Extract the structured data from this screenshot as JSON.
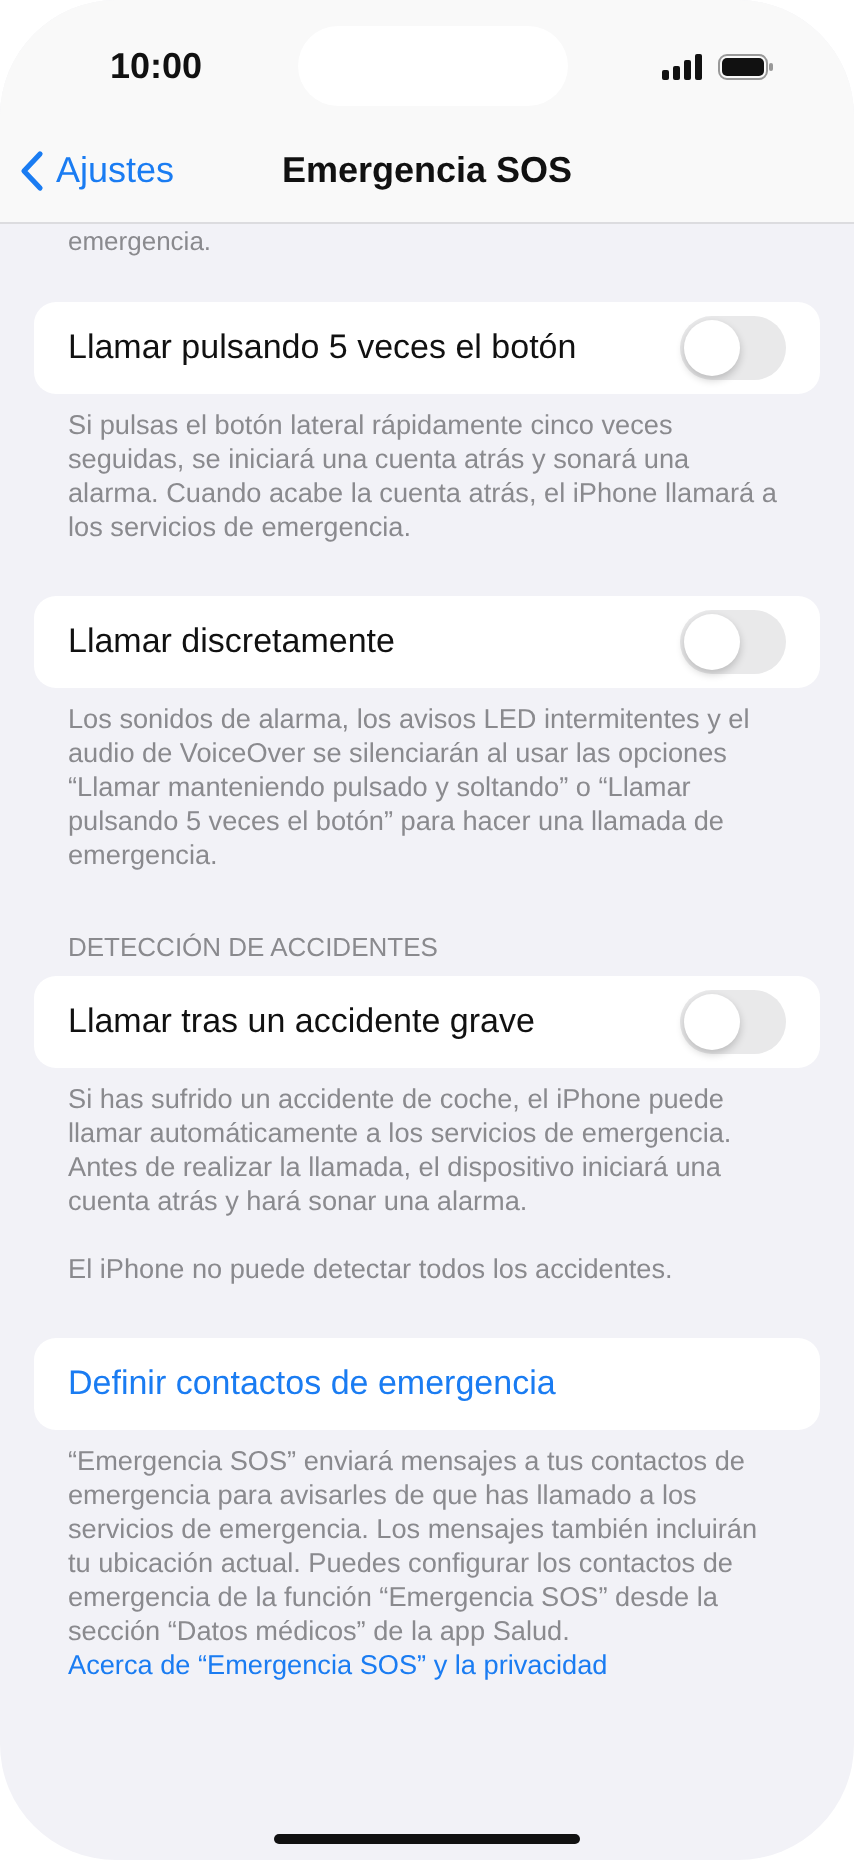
{
  "status_bar": {
    "time": "10:00"
  },
  "nav": {
    "back": "Ajustes",
    "title": "Emergencia SOS"
  },
  "cut_text": "emergencia.",
  "sections": [
    {
      "kind": "toggle",
      "label": "Llamar pulsando 5 veces el botón",
      "on": false,
      "footer": [
        "Si pulsas el botón lateral rápidamente cinco veces seguidas, se iniciará una cuenta atrás y sonará una alarma. Cuando acabe la cuenta atrás, el iPhone llamará a los servicios de emergencia."
      ]
    },
    {
      "kind": "toggle",
      "label": "Llamar discretamente",
      "on": false,
      "footer": [
        "Los sonidos de alarma, los avisos LED intermitentes y el audio de VoiceOver se silenciarán al usar las opciones “Llamar manteniendo pulsado y soltando” o “Llamar pulsando 5 veces el botón” para hacer una llamada de emergencia."
      ]
    },
    {
      "kind": "toggle",
      "header": "DETECCIÓN DE ACCIDENTES",
      "label": "Llamar tras un accidente grave",
      "on": false,
      "footer": [
        "Si has sufrido un accidente de coche, el iPhone puede llamar automáticamente a los servicios de emergencia. Antes de realizar la llamada, el dispositivo iniciará una cuenta atrás y hará sonar una alarma.",
        "El iPhone no puede detectar todos los accidentes."
      ]
    },
    {
      "kind": "link",
      "label": "Definir contactos de emergencia",
      "footer": [
        "“Emergencia SOS” enviará mensajes a tus contactos de emergencia para avisarles de que has llamado a los servicios de emergencia. Los mensajes también incluirán tu ubicación actual. Puedes configurar los contactos de emergencia de la función “Emergencia SOS” desde la sección “Datos médicos” de la app Salud."
      ],
      "footer_link": "Acerca de “Emergencia SOS” y la privacidad"
    }
  ]
}
